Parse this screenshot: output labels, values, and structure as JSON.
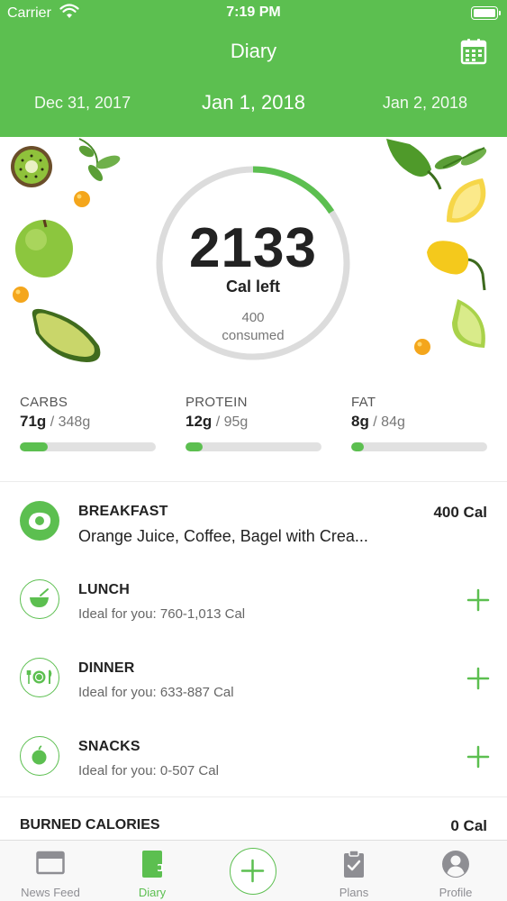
{
  "status_bar": {
    "carrier": "Carrier",
    "time": "7:19 PM"
  },
  "header": {
    "title": "Diary",
    "calendar_icon": "calendar-icon",
    "dates": {
      "previous": "Dec 31, 2017",
      "current": "Jan 1, 2018",
      "next": "Jan 2, 2018"
    }
  },
  "summary": {
    "calories_left": "2133",
    "calories_left_label": "Cal left",
    "consumed_value": "400",
    "consumed_label": "consumed",
    "ring_progress": 0.158
  },
  "macros": [
    {
      "name": "CARBS",
      "value": "71g",
      "total": " / 348g",
      "progress": 0.204
    },
    {
      "name": "PROTEIN",
      "value": "12g",
      "total": " / 95g",
      "progress": 0.126
    },
    {
      "name": "FAT",
      "value": "8g",
      "total": " / 84g",
      "progress": 0.095
    }
  ],
  "meals": [
    {
      "title": "BREAKFAST",
      "subtitle": "Orange Juice, Coffee, Bagel with Crea...",
      "calories": "400 Cal",
      "icon": "egg-icon"
    },
    {
      "title": "LUNCH",
      "subtitle": "Ideal for you: 760-1,013 Cal",
      "icon": "bowl-icon"
    },
    {
      "title": "DINNER",
      "subtitle": "Ideal for you: 633-887 Cal",
      "icon": "plate-icon"
    },
    {
      "title": "SNACKS",
      "subtitle": "Ideal for you: 0-507 Cal",
      "icon": "apple-icon"
    }
  ],
  "burned": {
    "label": "BURNED CALORIES",
    "value": "0 Cal"
  },
  "tabbar": {
    "items": [
      {
        "label": "News Feed",
        "icon": "news-feed-icon"
      },
      {
        "label": "Diary",
        "icon": "diary-icon",
        "active": true
      },
      {
        "label": "",
        "icon": "plus-icon"
      },
      {
        "label": "Plans",
        "icon": "clipboard-icon"
      },
      {
        "label": "Profile",
        "icon": "person-icon"
      }
    ]
  },
  "colors": {
    "brand_green": "#5cbf50",
    "ring_track": "#dcdcdc",
    "bar_track": "#e1e1e1"
  }
}
